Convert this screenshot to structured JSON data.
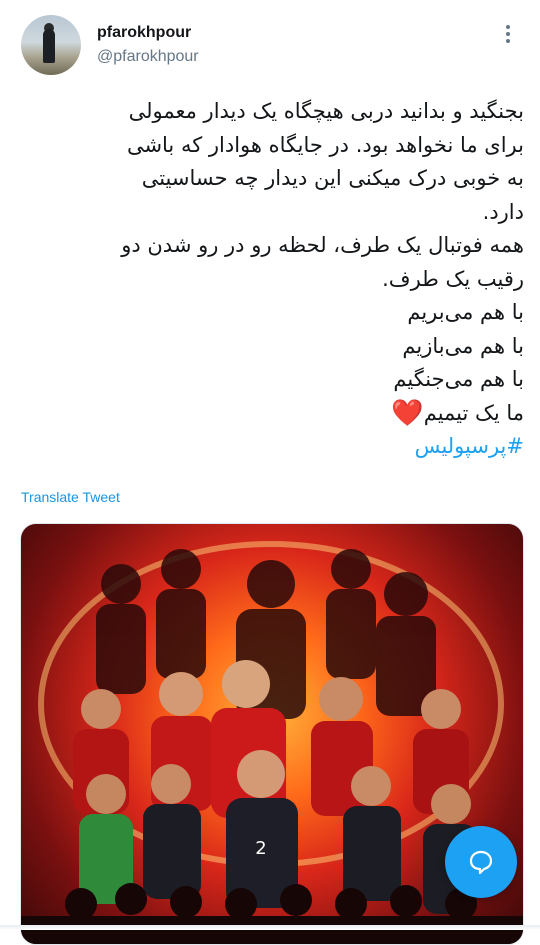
{
  "user": {
    "display_name": "pfarokhpour",
    "handle": "@pfarokhpour",
    "avatar_icon": "avatar-person-on-beach",
    "more_icon": "more-vertical-icon"
  },
  "tweet": {
    "lines": [
      "بجنگید و بدانید دربی هیچگاه یک دیدار معمولی",
      "برای ما نخواهد بود. در جایگاه هوادار که باشی",
      "به خوبی درک میکنی این دیدار چه حساسیتی",
      "دارد.",
      "همه فوتبال یک طرف، لحظه رو در رو شدن دو",
      "رقیب یک طرف.",
      "با هم می‌بریم",
      "با هم می‌بازیم",
      "با هم می‌جنگیم",
      "ما یک تیمیم"
    ],
    "heart_emoji": "❤️",
    "hashtag": "#پرسپولیس"
  },
  "translate_label": "Translate Tweet",
  "media": {
    "description_icon": "team-poster-image",
    "accent_colors": [
      "#ff6a1a",
      "#d9271a",
      "#7a1010"
    ]
  },
  "compose_button": {
    "icon": "chat-bubble-plus-icon",
    "color": "#1da1f2"
  }
}
